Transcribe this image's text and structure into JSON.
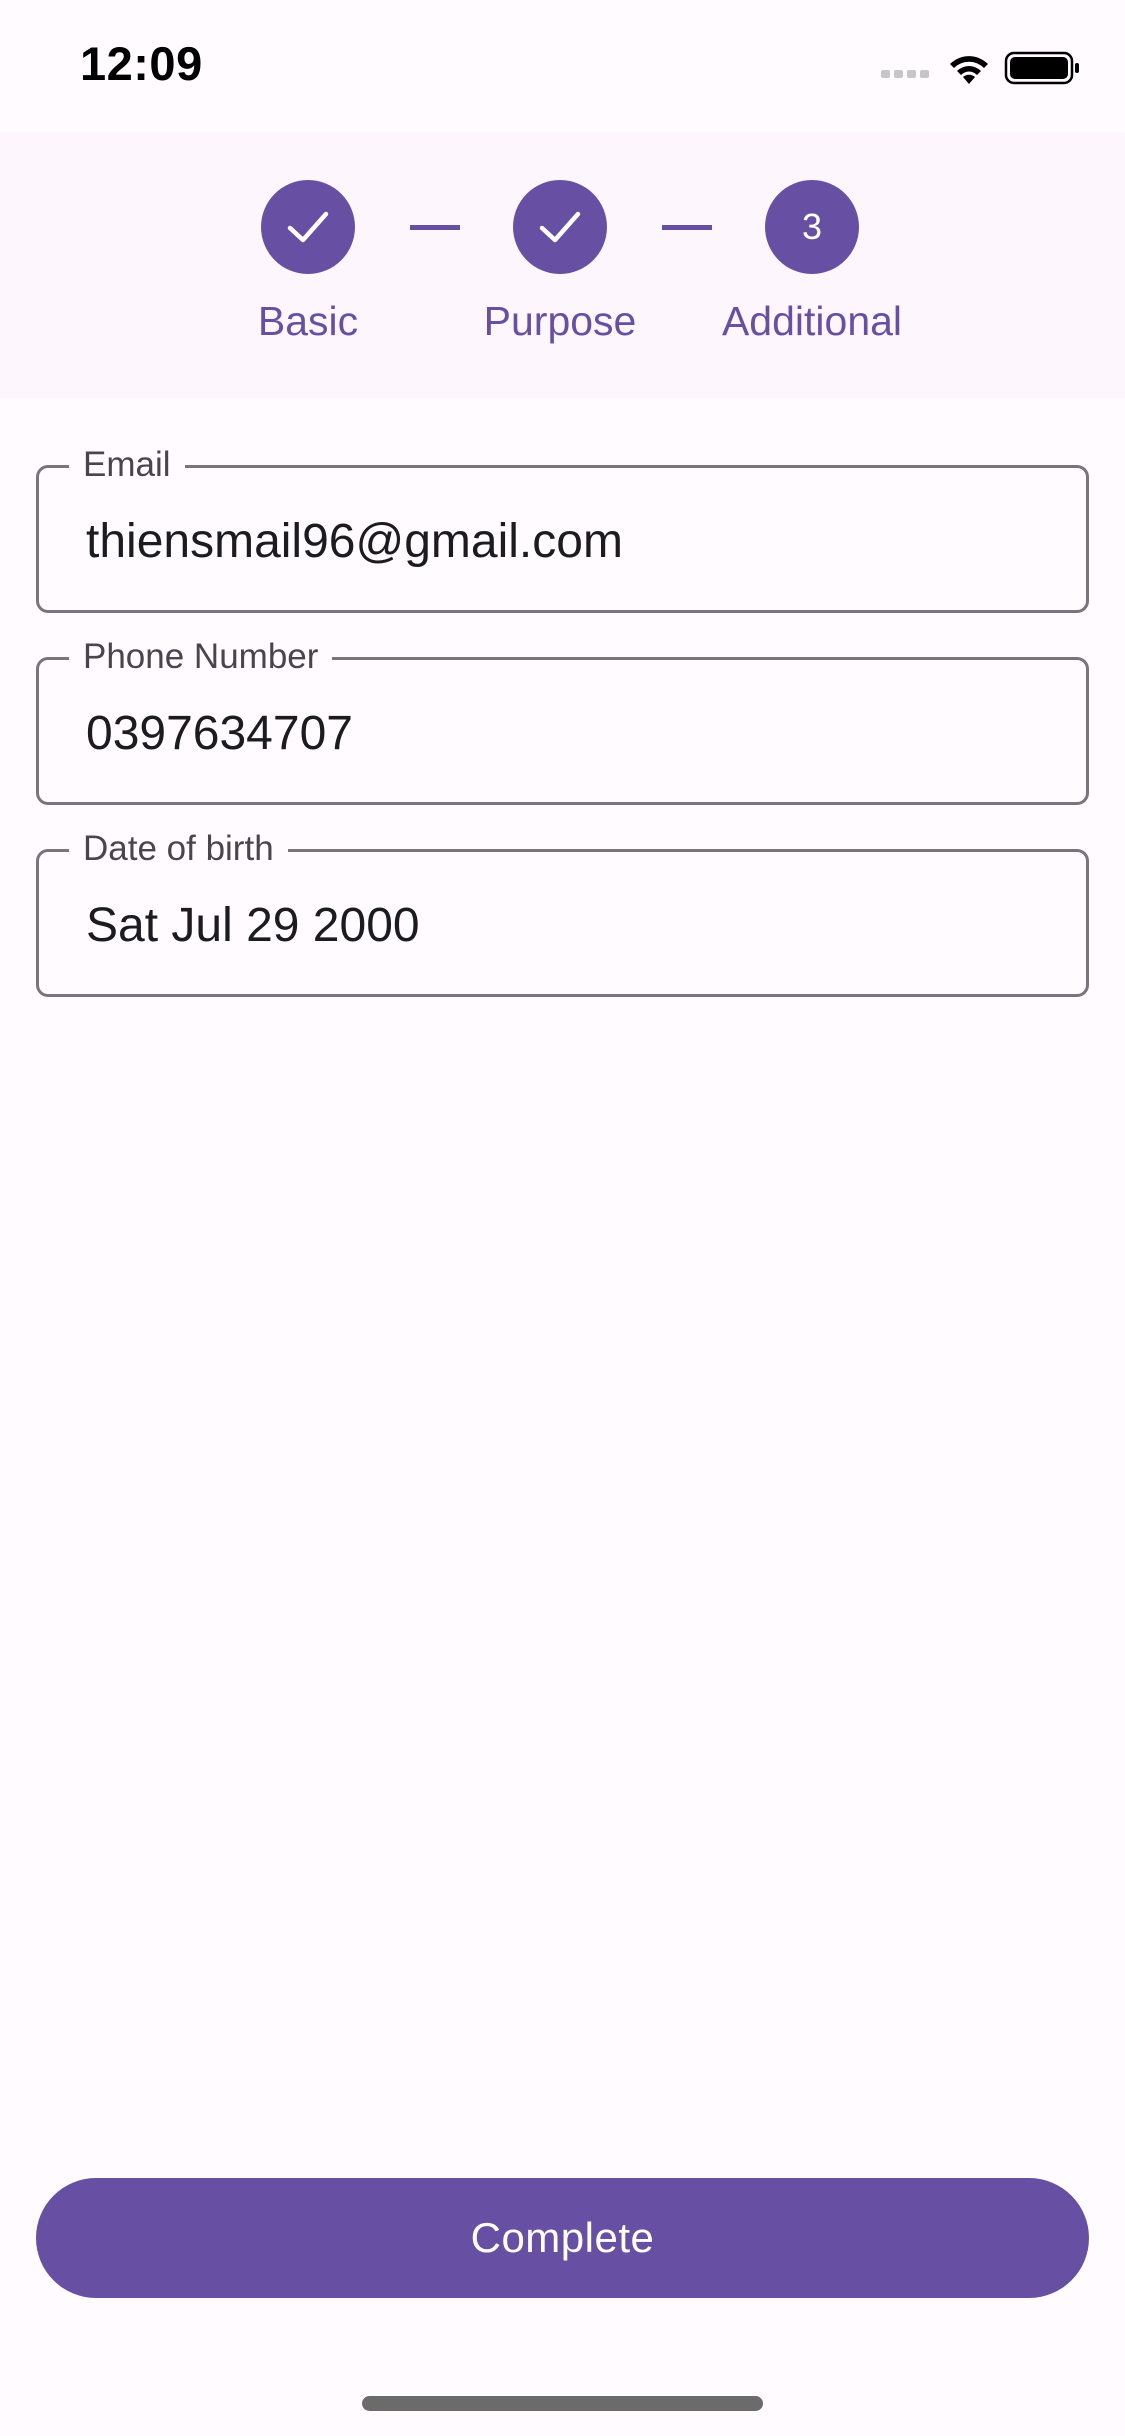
{
  "status_bar": {
    "time": "12:09"
  },
  "stepper": {
    "steps": [
      {
        "label": "Basic",
        "state": "completed",
        "icon": "check-icon"
      },
      {
        "label": "Purpose",
        "state": "completed",
        "icon": "check-icon"
      },
      {
        "label": "Additional",
        "state": "active",
        "number": "3"
      }
    ]
  },
  "form": {
    "email": {
      "label": "Email",
      "value": "thiensmail96@gmail.com"
    },
    "phone": {
      "label": "Phone Number",
      "value": "0397634707"
    },
    "dob": {
      "label": "Date of birth",
      "value": "Sat Jul 29 2000"
    }
  },
  "actions": {
    "complete_label": "Complete"
  },
  "colors": {
    "primary": "#6750a4",
    "background": "#fffbfe",
    "outline": "#79747e"
  }
}
